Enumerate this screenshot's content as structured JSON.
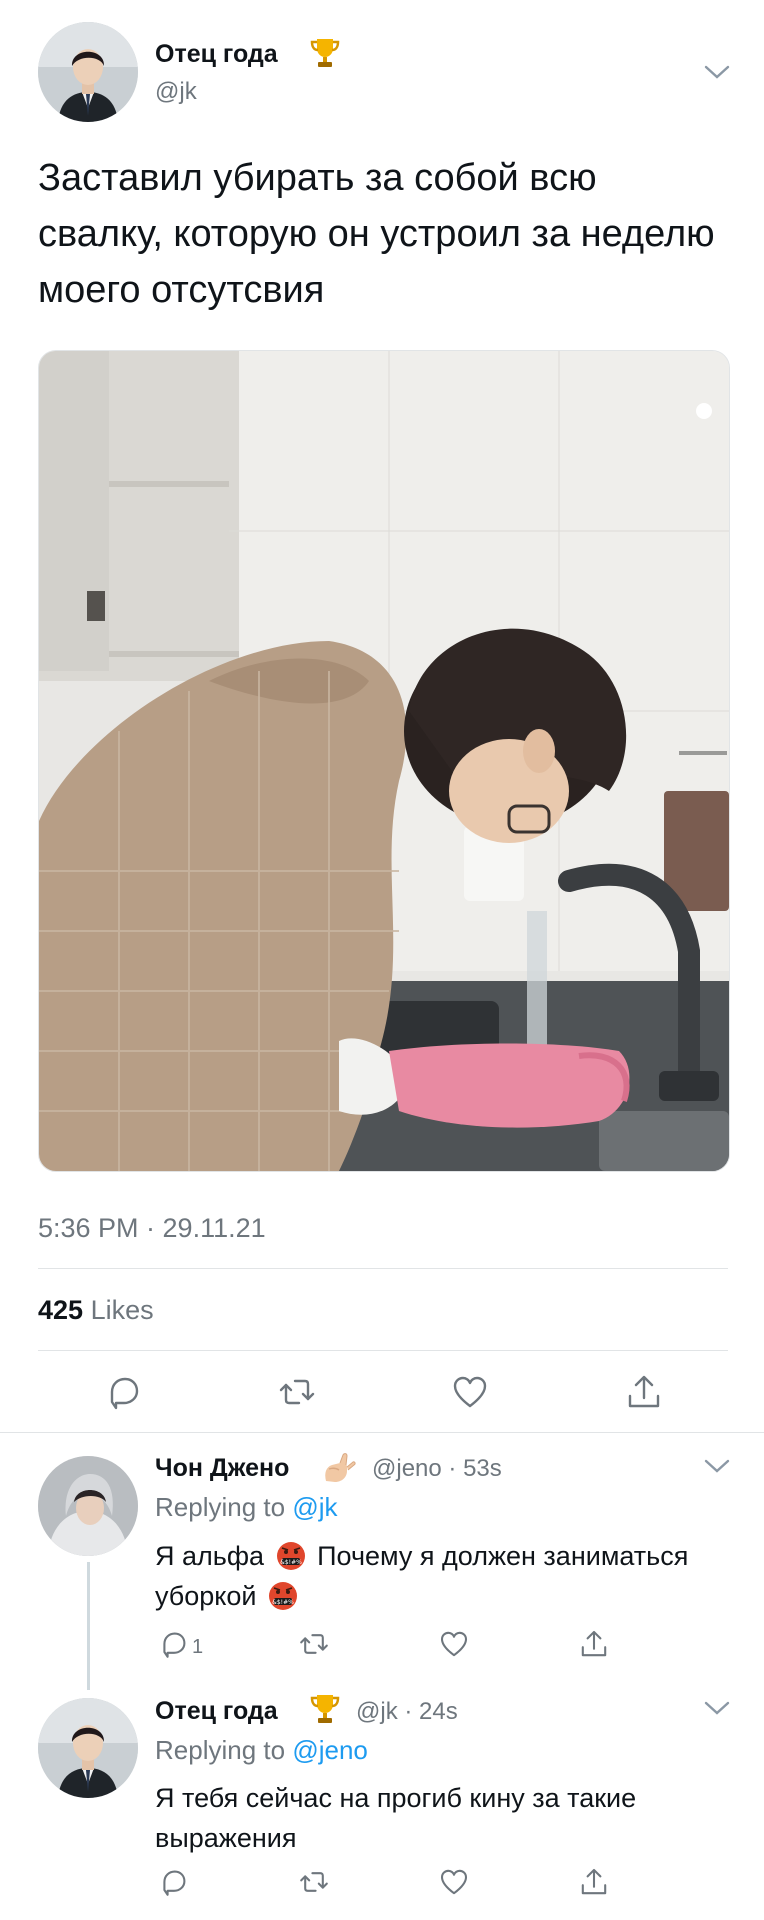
{
  "tweet": {
    "author_name": "Отец года",
    "author_handle": "@jk",
    "author_badge": "trophy-icon",
    "text": "Заставил убирать за собой всю свалку, которую он устроил за неделю моего отсутсвия",
    "photo": "person-washing-dishes-photo",
    "timestamp": "5:36 PM · 29.11.21",
    "likes_count": "425",
    "likes_label": "Likes"
  },
  "replies": [
    {
      "author_name": "Чон Джено",
      "author_badge": "pinching-hand-emoji",
      "handle_time": "@jeno · 53s",
      "replying_label": "Replying to",
      "replying_to": "@jk",
      "text_part1": "Я альфа",
      "text_part2": "Почему я должен заниматься уборкой",
      "emoji": "cursing-face-emoji",
      "reply_count": "1"
    },
    {
      "author_name": "Отец года",
      "author_badge": "trophy-icon",
      "handle_time": "@jk · 24s",
      "replying_label": "Replying to",
      "replying_to": "@jeno",
      "text": "Я тебя сейчас на прогиб кину за такие выражения"
    }
  ],
  "colors": {
    "text": "#0f1419",
    "secondary": "#6e767d",
    "link": "#1d9bf0",
    "divider": "#e1e4e6"
  }
}
